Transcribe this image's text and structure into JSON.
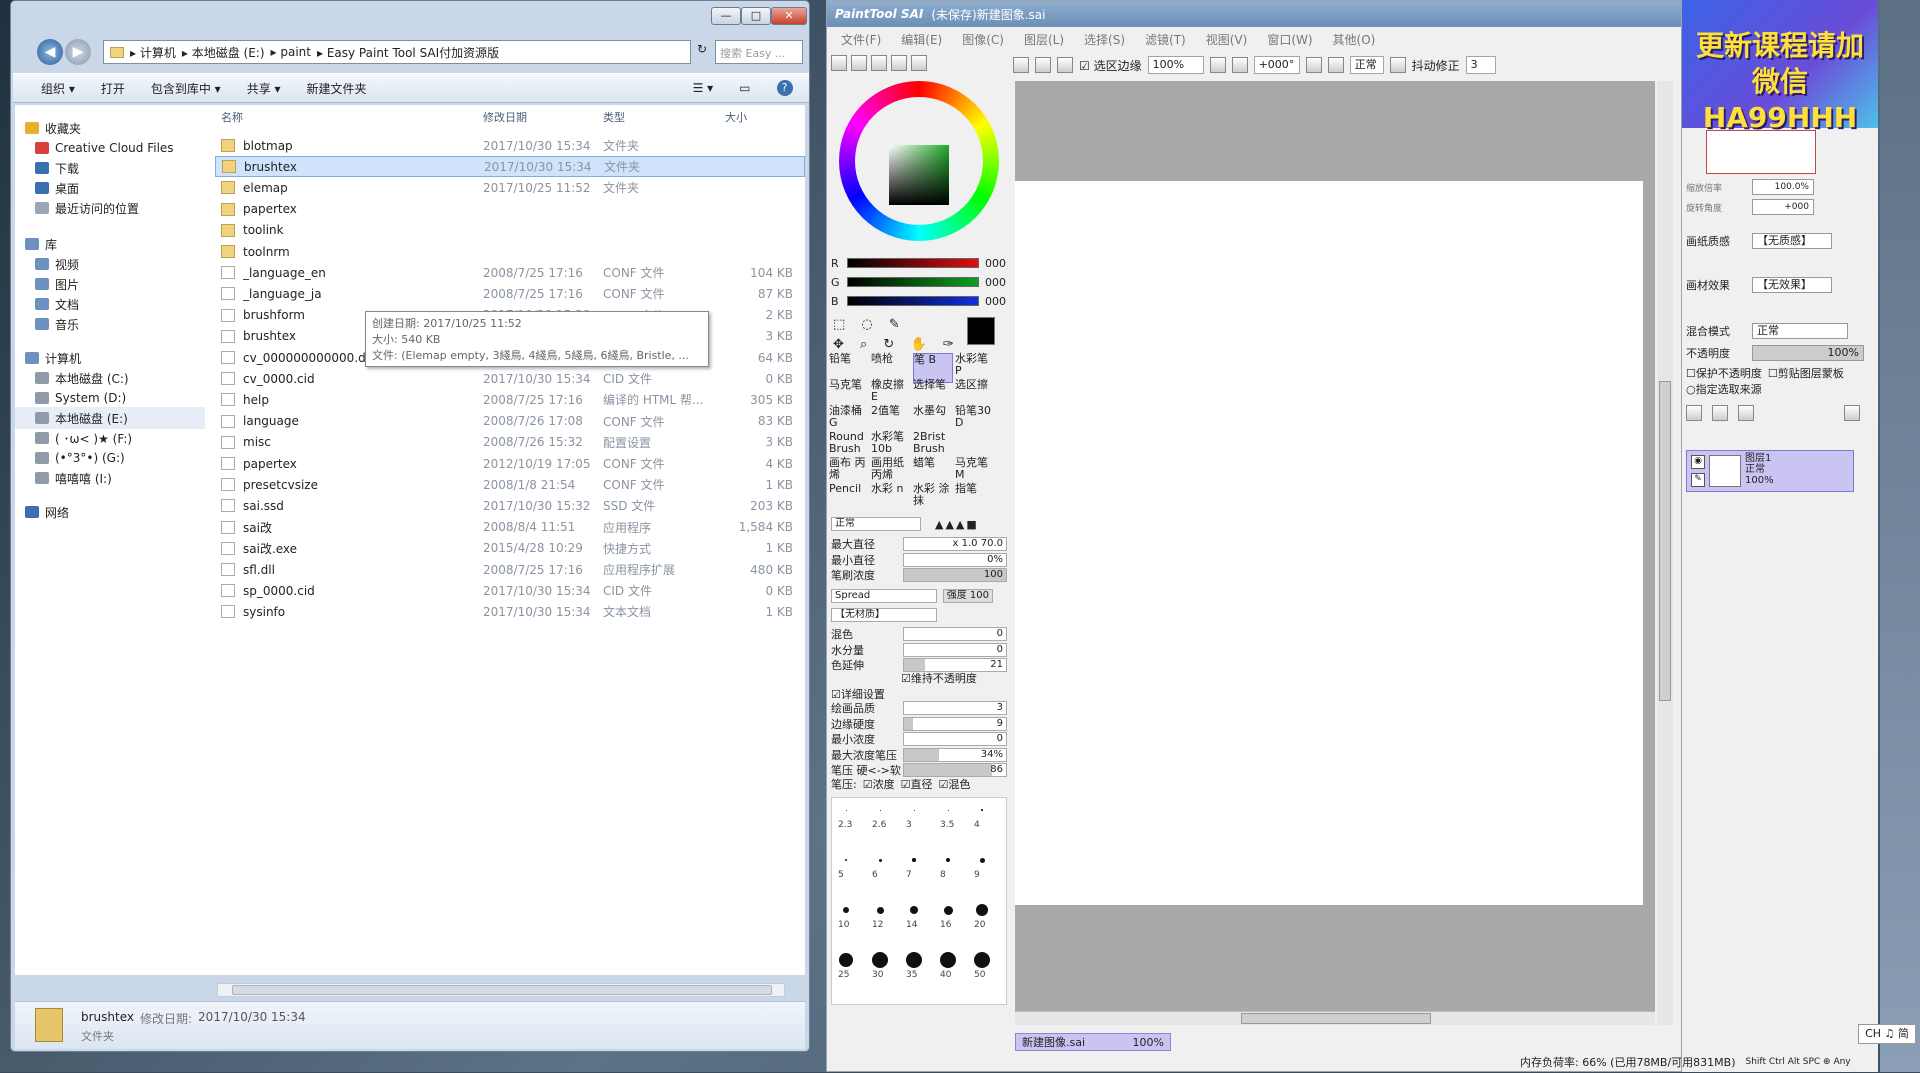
{
  "explorer": {
    "window_buttons": [
      "—",
      "□",
      "✕"
    ],
    "breadcrumb": [
      "计算机",
      "本地磁盘 (E:)",
      "paint",
      "Easy Paint Tool SAI付加资源版"
    ],
    "search_placeholder": "搜索 Easy ...",
    "toolbar": [
      "组织 ▾",
      "打开",
      "包含到库中 ▾",
      "共享 ▾",
      "新建文件夹"
    ],
    "columns": {
      "name": "名称",
      "date": "修改日期",
      "type": "类型",
      "size": "大小"
    },
    "nav": [
      {
        "label": "收藏夹",
        "color": "#e6b030"
      },
      {
        "label": "Creative Cloud Files",
        "color": "#d84040"
      },
      {
        "label": "下载",
        "color": "#3a6fb0"
      },
      {
        "label": "桌面",
        "color": "#3a6fb0"
      },
      {
        "label": "最近访问的位置",
        "color": "#9aa7b8"
      },
      {
        "label": "库",
        "color": "#6d90c0"
      },
      {
        "label": "视频",
        "color": "#6d90c0"
      },
      {
        "label": "图片",
        "color": "#6d90c0"
      },
      {
        "label": "文档",
        "color": "#6d90c0"
      },
      {
        "label": "音乐",
        "color": "#6d90c0"
      },
      {
        "label": "计算机",
        "color": "#6d90c0"
      },
      {
        "label": "本地磁盘 (C:)",
        "color": "#909aa8"
      },
      {
        "label": "System (D:)",
        "color": "#909aa8"
      },
      {
        "label": "本地磁盘 (E:)",
        "color": "#909aa8"
      },
      {
        "label": "( ･ω< )★ (F:)",
        "color": "#909aa8"
      },
      {
        "label": "(•°3°•) (G:)",
        "color": "#909aa8"
      },
      {
        "label": "嘻嘻嘻 (I:)",
        "color": "#909aa8"
      },
      {
        "label": "网络",
        "color": "#3a6fb0"
      }
    ],
    "files": [
      {
        "name": "blotmap",
        "date": "2017/10/30 15:34",
        "type": "文件夹",
        "size": "",
        "folder": true
      },
      {
        "name": "brushtex",
        "date": "2017/10/30 15:34",
        "type": "文件夹",
        "size": "",
        "folder": true
      },
      {
        "name": "elemap",
        "date": "2017/10/25 11:52",
        "type": "文件夹",
        "size": "",
        "folder": true
      },
      {
        "name": "papertex",
        "date": "",
        "type": "",
        "size": "",
        "folder": true
      },
      {
        "name": "toolink",
        "date": "",
        "type": "",
        "size": "",
        "folder": true
      },
      {
        "name": "toolnrm",
        "date": "",
        "type": "",
        "size": "",
        "folder": true
      },
      {
        "name": "_language_en",
        "date": "2008/7/25 17:16",
        "type": "CONF 文件",
        "size": "104 KB",
        "folder": false
      },
      {
        "name": "_language_ja",
        "date": "2008/7/25 17:16",
        "type": "CONF 文件",
        "size": "87 KB",
        "folder": false
      },
      {
        "name": "brushform",
        "date": "2017/10/30 15:29",
        "type": "CONF 文件",
        "size": "2 KB",
        "folder": false
      },
      {
        "name": "brushtex",
        "date": "2017/10/30 15:29",
        "type": "CONF 文件",
        "size": "3 KB",
        "folder": false
      },
      {
        "name": "cv_000000000000.dat",
        "date": "2017/10/30 15:41",
        "type": "DAT 文件",
        "size": "64 KB",
        "folder": false
      },
      {
        "name": "cv_0000.cid",
        "date": "2017/10/30 15:34",
        "type": "CID 文件",
        "size": "0 KB",
        "folder": false
      },
      {
        "name": "help",
        "date": "2008/7/25 17:16",
        "type": "编译的 HTML 帮...",
        "size": "305 KB",
        "folder": false
      },
      {
        "name": "language",
        "date": "2008/7/26 17:08",
        "type": "CONF 文件",
        "size": "83 KB",
        "folder": false
      },
      {
        "name": "misc",
        "date": "2008/7/26 15:32",
        "type": "配置设置",
        "size": "3 KB",
        "folder": false
      },
      {
        "name": "papertex",
        "date": "2012/10/19 17:05",
        "type": "CONF 文件",
        "size": "4 KB",
        "folder": false
      },
      {
        "name": "presetcvsize",
        "date": "2008/1/8 21:54",
        "type": "CONF 文件",
        "size": "1 KB",
        "folder": false
      },
      {
        "name": "sai.ssd",
        "date": "2017/10/30 15:32",
        "type": "SSD 文件",
        "size": "203 KB",
        "folder": false
      },
      {
        "name": "sai改",
        "date": "2008/8/4 11:51",
        "type": "应用程序",
        "size": "1,584 KB",
        "folder": false
      },
      {
        "name": "sai改.exe",
        "date": "2015/4/28 10:29",
        "type": "快捷方式",
        "size": "1 KB",
        "folder": false
      },
      {
        "name": "sfl.dll",
        "date": "2008/7/25 17:16",
        "type": "应用程序扩展",
        "size": "480 KB",
        "folder": false
      },
      {
        "name": "sp_0000.cid",
        "date": "2017/10/30 15:34",
        "type": "CID 文件",
        "size": "0 KB",
        "folder": false
      },
      {
        "name": "sysinfo",
        "date": "2017/10/30 15:34",
        "type": "文本文档",
        "size": "1 KB",
        "folder": false
      }
    ],
    "selected_index": 1,
    "tooltip": {
      "line1": "创建日期: 2017/10/25 11:52",
      "line2": "大小: 540 KB",
      "line3": "文件: (Elemap empty, 3綫鳥, 4綫鳥, 5綫鳥, 6綫鳥, Bristle, ..."
    },
    "details": {
      "name": "brushtex",
      "modified_label": "修改日期:",
      "modified": "2017/10/30 15:34",
      "type": "文件夹"
    }
  },
  "sai": {
    "title": "PaintTool SAI",
    "doc_title": "(未保存)新建图象.sai",
    "menu": [
      "文件(F)",
      "编辑(E)",
      "图像(C)",
      "图层(L)",
      "选择(S)",
      "滤镜(T)",
      "视图(V)",
      "窗口(W)",
      "其他(O)"
    ],
    "toolbar": {
      "edge_label": "选区边缘",
      "zoom": "100%",
      "angle": "+000°",
      "blend": "正常",
      "stab_label": "抖动修正",
      "stab": "3"
    },
    "rgb": [
      {
        "label": "R",
        "value": "000"
      },
      {
        "label": "G",
        "value": "000"
      },
      {
        "label": "B",
        "value": "000"
      }
    ],
    "brushes": [
      "铅笔",
      "喷枪",
      "笔 B",
      "水彩笔 P",
      "马克笔",
      "橡皮擦 E",
      "选择笔",
      "选区擦",
      "油漆桶 G",
      "2值笔",
      "水墨勾",
      "铅笔30 D",
      "Round Brush",
      "水彩笔10b",
      "2Brist Brush",
      "",
      "画布 丙烯",
      "画用纸 丙烯",
      "蜡笔",
      "马克笔 M",
      "Pencil",
      "水彩 n",
      "水彩 涂抹",
      "指笔"
    ],
    "mode": "正常",
    "params": [
      {
        "label": "最大直径",
        "value": "x 1.0     70.0",
        "fill": 0
      },
      {
        "label": "最小直径",
        "value": "0%",
        "fill": 0
      },
      {
        "label": "笔刷浓度",
        "value": "100",
        "fill": 1
      }
    ],
    "shape": "Spread",
    "shape_strength": "强度 100",
    "texture": "【无材质】",
    "mix_params": [
      {
        "label": "混色",
        "value": "0",
        "fill": 0
      },
      {
        "label": "水分量",
        "value": "0",
        "fill": 0
      },
      {
        "label": "色延伸",
        "value": "21",
        "fill": 0.21
      }
    ],
    "keep_opacity": "维持不透明度",
    "detail_label": "详细设置",
    "detail_params": [
      {
        "label": "绘画品质",
        "value": "3",
        "fill": 0
      },
      {
        "label": "边缘硬度",
        "value": "9",
        "fill": 0.09
      },
      {
        "label": "最小浓度",
        "value": "0",
        "fill": 0
      },
      {
        "label": "最大浓度笔压",
        "value": "34%",
        "fill": 0.34
      },
      {
        "label": "笔压 硬<->软",
        "value": "86",
        "fill": 0.86
      }
    ],
    "pressure_row": {
      "label": "笔压:",
      "opts": [
        "浓度",
        "直径",
        "混色"
      ]
    },
    "dot_labels": [
      "2.3",
      "2.6",
      "3",
      "3.5",
      "4",
      "5",
      "6",
      "7",
      "8",
      "9",
      "10",
      "12",
      "14",
      "16",
      "20",
      "25",
      "30",
      "35",
      "40",
      "50"
    ],
    "doc_tab": {
      "name": "新建图像.sai",
      "zoom": "100%"
    }
  },
  "sai_right": {
    "promo": [
      "更新课程请加",
      "微信HA99HHH"
    ],
    "zoom_label": "缩放倍率",
    "zoom_value": "100.0%",
    "rotate_label": "旋转角度",
    "rotate_value": "+000",
    "paper_label": "画纸质感",
    "paper_value": "【无质感】",
    "effect_label": "画材效果",
    "effect_value": "【无效果】",
    "blend_label": "混合模式",
    "blend_value": "正常",
    "opacity_label": "不透明度",
    "opacity_value": "100%",
    "protect_label": "保护不透明度",
    "clip_label": "剪贴图层蒙板",
    "select_src_label": "指定选取来源",
    "layer": {
      "name": "图层1",
      "mode": "正常",
      "opacity": "100%"
    }
  },
  "status": {
    "memory": "内存负荷率: 66% (已用78MB/可用831MB)",
    "keys": "Shift Ctrl Alt SPC ⊕ Any",
    "ime": "CH ♫ 简"
  }
}
